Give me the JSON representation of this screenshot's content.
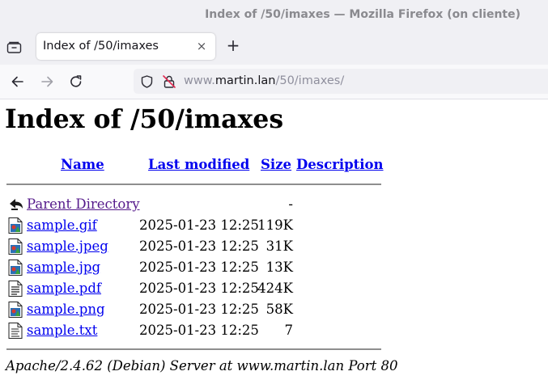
{
  "window": {
    "title": "Index of /50/imaxes — Mozilla Firefox (on cliente)"
  },
  "tabs": {
    "active_title": "Index of /50/imaxes",
    "close_symbol": "×",
    "new_tab_symbol": "+"
  },
  "navbar": {
    "back_icon": "arrow-left-icon",
    "forward_icon": "arrow-right-icon",
    "reload_icon": "reload-icon",
    "url_prefix": "www.",
    "url_host": "martin.lan",
    "url_path": "/50/imaxes/"
  },
  "page": {
    "title": "Index of /50/imaxes",
    "columns": {
      "name": "Name",
      "last_modified": "Last modified",
      "size": "Size",
      "description": "Description"
    },
    "parent": {
      "name": "Parent Directory",
      "size": "-",
      "icon": "back-arrow-icon"
    },
    "files": [
      {
        "name": "sample.gif",
        "date": "2025-01-23 12:25",
        "size": "119K",
        "icon": "image-icon"
      },
      {
        "name": "sample.jpeg",
        "date": "2025-01-23 12:25",
        "size": "31K",
        "icon": "image-icon"
      },
      {
        "name": "sample.jpg",
        "date": "2025-01-23 12:25",
        "size": "13K",
        "icon": "image-icon"
      },
      {
        "name": "sample.pdf",
        "date": "2025-01-23 12:25",
        "size": "424K",
        "icon": "document-icon"
      },
      {
        "name": "sample.png",
        "date": "2025-01-23 12:25",
        "size": "58K",
        "icon": "image-icon"
      },
      {
        "name": "sample.txt",
        "date": "2025-01-23 12:25",
        "size": "7",
        "icon": "text-file-icon"
      }
    ],
    "footer": "Apache/2.4.62 (Debian) Server at www.martin.lan Port 80"
  }
}
